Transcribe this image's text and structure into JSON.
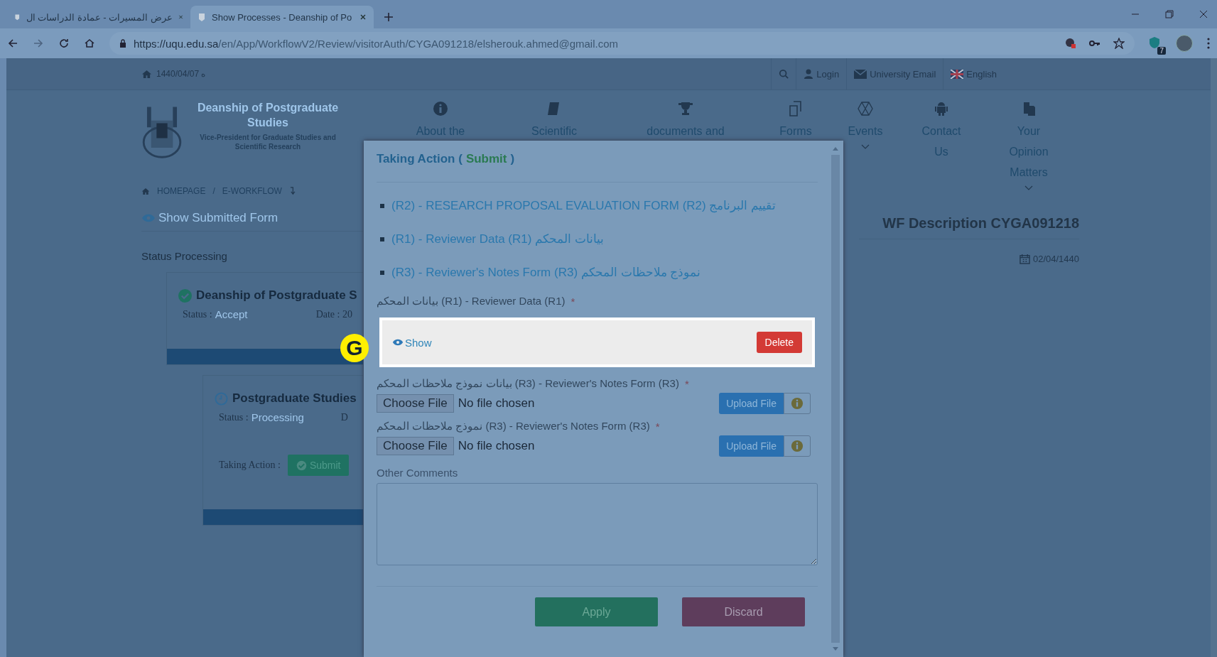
{
  "browser": {
    "tabs": [
      {
        "title": "عرض المسيرات - عمادة الدراسات ال",
        "selected": false
      },
      {
        "title": "Show Processes - Deanship of Po",
        "selected": true
      }
    ],
    "url": {
      "host": "https://uqu.edu.sa",
      "path": "/en/App/WorkflowV2/Review/visitorAuth/CYGA091218/elsherouk.ahmed@gmail.com"
    },
    "extension_badge": "7"
  },
  "topbar": {
    "date": "1440/04/07 ه",
    "links": [
      {
        "label": "Login",
        "kind": "user"
      },
      {
        "label": "University Email",
        "kind": "mail"
      },
      {
        "label": "English",
        "kind": "flag"
      }
    ]
  },
  "header": {
    "title": "Deanship of Postgraduate Studies",
    "subtitle": "Vice-President for Graduate Studies and Scientific Research",
    "nav": [
      {
        "label": "About the",
        "kind": "info",
        "dropdown": false
      },
      {
        "label": "Scientific",
        "kind": "book",
        "dropdown": false
      },
      {
        "label": "documents and",
        "kind": "trophy",
        "dropdown": false
      },
      {
        "label": "Forms",
        "kind": "forms",
        "dropdown": false
      },
      {
        "label": "Events",
        "kind": "hexagon",
        "dropdown": true
      },
      {
        "label": "Contact Us",
        "kind": "android",
        "dropdown": false
      },
      {
        "label": "Your Opinion Matters",
        "kind": "copy",
        "dropdown": true
      }
    ]
  },
  "breadcrumb": {
    "items": [
      "HOMEPAGE",
      "E-WORKFLOW"
    ],
    "separator": "/"
  },
  "show_submitted_form": "Show Submitted Form",
  "status_heading": "Status Processing",
  "steps": [
    {
      "kind": "done",
      "title": "Deanship of Postgraduate S",
      "status_label": "Status :",
      "status": "Accept",
      "date": "Date : 20"
    },
    {
      "kind": "pending",
      "title": "Postgraduate Studies",
      "status_label": "Status :",
      "status": "Processing",
      "date": "D",
      "action_label": "Taking Action :",
      "action_button": "Submit"
    }
  ],
  "wf": {
    "title": "WF Description CYGA091218",
    "date": "02/04/1440"
  },
  "modal": {
    "title_prefix": "Taking Action (",
    "action": "Submit",
    "title_suffix": ")",
    "forms": [
      "(R2) - RESEARCH PROPOSAL EVALUATION FORM (R2) تقييم البرنامج",
      "(R1) - Reviewer Data (R1) بيانات المحكم",
      "(R3) - Reviewer's Notes Form (R3) نموذج ملاحظات المحكم"
    ],
    "fields": [
      {
        "kind": "uploaded",
        "label": "بيانات المحكم (R1) - Reviewer Data (R1)",
        "required_mark": "*",
        "show": "Show",
        "delete": "Delete"
      },
      {
        "kind": "file",
        "label": "بيانات نموذج ملاحظات المحكم (R3) - Reviewer's Notes Form (R3)",
        "required_mark": "*",
        "choose": "Choose File",
        "status": "No file chosen",
        "upload": "Upload File"
      },
      {
        "kind": "file",
        "label": "نموذج ملاحظات المحكم (R3) - Reviewer's Notes Form (R3)",
        "required_mark": "*",
        "choose": "Choose File",
        "status": "No file chosen",
        "upload": "Upload File"
      }
    ],
    "comments_label": "Other Comments",
    "buttons": [
      {
        "label": "Apply",
        "kind": "apply"
      },
      {
        "label": "Discard",
        "kind": "discard"
      }
    ]
  },
  "marker": "G"
}
